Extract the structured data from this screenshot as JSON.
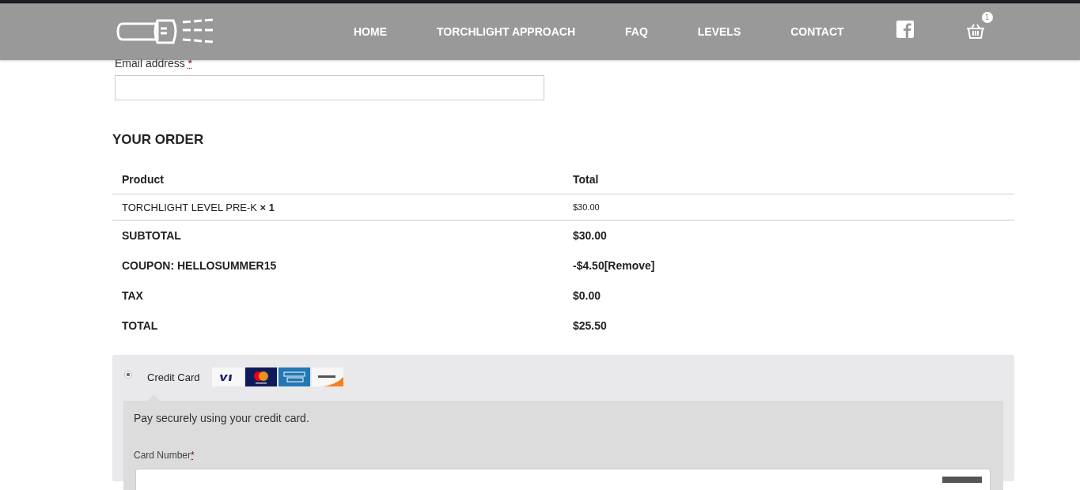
{
  "header": {
    "nav": [
      {
        "label": "HOME"
      },
      {
        "label": "TORCHLIGHT APPROACH"
      },
      {
        "label": "FAQ"
      },
      {
        "label": "LEVELS"
      },
      {
        "label": "CONTACT"
      }
    ],
    "cart_count": "1"
  },
  "billing": {
    "email_label": "Email address",
    "required_mark": "*"
  },
  "order": {
    "title": "YOUR ORDER",
    "columns": [
      "Product",
      "Total"
    ],
    "item": {
      "name": "TORCHLIGHT LEVEL PRE-K",
      "qty": "× 1",
      "total": "$30.00"
    },
    "totals": [
      {
        "label": "SUBTOTAL",
        "value": "$30.00"
      },
      {
        "label": "COUPON: HELLOSUMMER15",
        "value": "-$4.50",
        "link": "[Remove]"
      },
      {
        "label": "TAX",
        "value": "$0.00"
      },
      {
        "label": "TOTAL",
        "value": "$25.50"
      }
    ]
  },
  "payment": {
    "method": {
      "label": "Credit Card",
      "selected": true
    },
    "description": "Pay securely using your credit card.",
    "card_number_label": "Card Number",
    "required_mark": "*"
  }
}
